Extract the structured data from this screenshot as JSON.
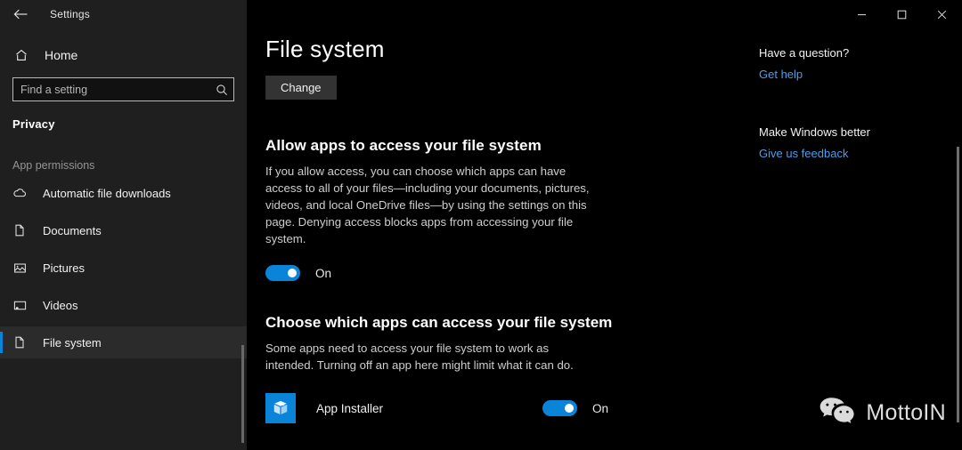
{
  "window": {
    "title": "Settings",
    "back_icon": "back-arrow-icon",
    "minimize_label": "–",
    "maximize_label": "□",
    "close_label": "✕"
  },
  "sidebar": {
    "home": {
      "label": "Home",
      "icon": "home-icon"
    },
    "search": {
      "value": "",
      "placeholder": "Find a setting",
      "icon": "search-icon"
    },
    "section_title": "Privacy",
    "group_label": "App permissions",
    "items": [
      {
        "label": "Automatic file downloads",
        "icon": "cloud-icon",
        "selected": false
      },
      {
        "label": "Documents",
        "icon": "document-icon",
        "selected": false
      },
      {
        "label": "Pictures",
        "icon": "picture-icon",
        "selected": false
      },
      {
        "label": "Videos",
        "icon": "video-icon",
        "selected": false
      },
      {
        "label": "File system",
        "icon": "document-icon",
        "selected": true
      }
    ]
  },
  "main": {
    "page_title": "File system",
    "change_button": "Change",
    "section1": {
      "heading": "Allow apps to access your file system",
      "body": "If you allow access, you can choose which apps can have access to all of your files—including your documents, pictures, videos, and local OneDrive files—by using the settings on this page. Denying access blocks apps from accessing your file system.",
      "toggle_state": "On"
    },
    "section2": {
      "heading": "Choose which apps can access your file system",
      "body": "Some apps need to access your file system to work as intended. Turning off an app here might limit what it can do.",
      "apps": [
        {
          "name": "App Installer",
          "icon": "package-icon",
          "toggle_state": "On"
        }
      ]
    }
  },
  "right_panel": {
    "question_heading": "Have a question?",
    "get_help_link": "Get help",
    "better_heading": "Make Windows better",
    "feedback_link": "Give us feedback"
  },
  "watermark": {
    "text": "MottoIN",
    "icon": "wechat-bubbles-icon"
  },
  "colors": {
    "accent": "#0a84d8",
    "link": "#4a9eea",
    "sidebar_bg": "#1f1f1f",
    "page_bg": "#000000"
  }
}
